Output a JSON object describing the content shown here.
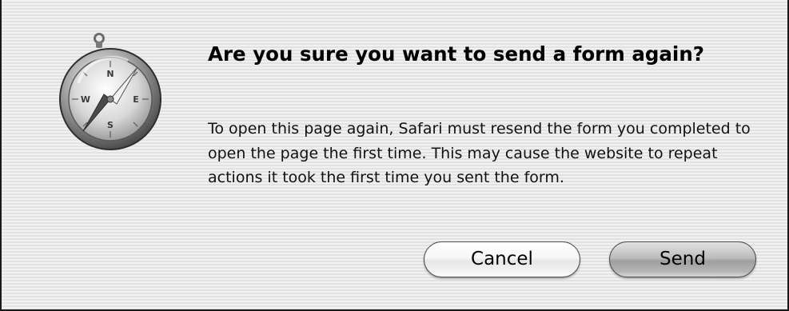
{
  "dialog": {
    "icon": "safari-compass-icon",
    "title": "Are you sure you want to send a form again?",
    "message": "To open this page again, Safari must resend the form you completed to open the page the first time. This may cause the website to repeat actions it took the first time you sent the form.",
    "buttons": {
      "cancel_label": "Cancel",
      "send_label": "Send"
    }
  }
}
